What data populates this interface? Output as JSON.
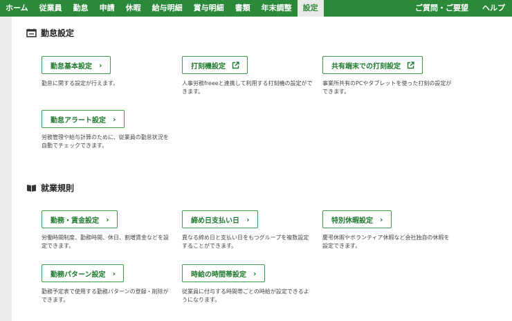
{
  "nav": {
    "left": [
      "ホーム",
      "従業員",
      "勤怠",
      "申請",
      "休暇",
      "給与明細",
      "賞与明細",
      "書類",
      "年末調整",
      "設定"
    ],
    "active_index": 9,
    "right": [
      "ご質問・ご要望",
      "ヘルプ"
    ]
  },
  "colors": {
    "brand": "#2a8a3a",
    "button_text": "#1e7a2e"
  },
  "sections": {
    "attendance": {
      "title": "勤怠設定",
      "icon": "calendar-icon",
      "cards": [
        {
          "label": "勤怠基本設定",
          "icon": "chevron-right-icon",
          "desc": "勤怠に関する設定が行えます。"
        },
        {
          "label": "打刻機設定",
          "icon": "external-link-icon",
          "desc": "人事労務freeeと連携して利用する打刻機の設定ができます。"
        },
        {
          "label": "共有端末での打刻設定",
          "icon": "external-link-icon",
          "desc": "事業所共有のPCやタブレットを使った打刻の設定ができます。"
        },
        {
          "label": "勤怠アラート設定",
          "icon": "chevron-right-icon",
          "desc": "労務管理や給与計算のために、従業員の勤怠状況を自動でチェックできます。"
        }
      ]
    },
    "work_rules": {
      "title": "就業規則",
      "icon": "book-icon",
      "cards": [
        {
          "label": "勤務・賃金設定",
          "icon": "chevron-right-icon",
          "desc": "労働時間制度、勤務時間、休日、割増賃金などを設定できます。"
        },
        {
          "label": "締め日支払い日",
          "icon": "chevron-right-icon",
          "desc": "異なる締め日と支払い日をもつグループを複数設定することができます。"
        },
        {
          "label": "特別休暇設定",
          "icon": "chevron-right-icon",
          "desc": "慶弔休暇やボランティア休暇など会社独自の休暇を設定できます。"
        },
        {
          "label": "勤務パターン設定",
          "icon": "chevron-right-icon",
          "desc": "勤務予定表で使用する勤務パターンの登録・削除ができます。"
        },
        {
          "label": "時給の時間帯設定",
          "icon": "chevron-right-icon",
          "desc": "従業員に付与する時間帯ごとの時給が設定できるようになります。"
        }
      ]
    }
  }
}
